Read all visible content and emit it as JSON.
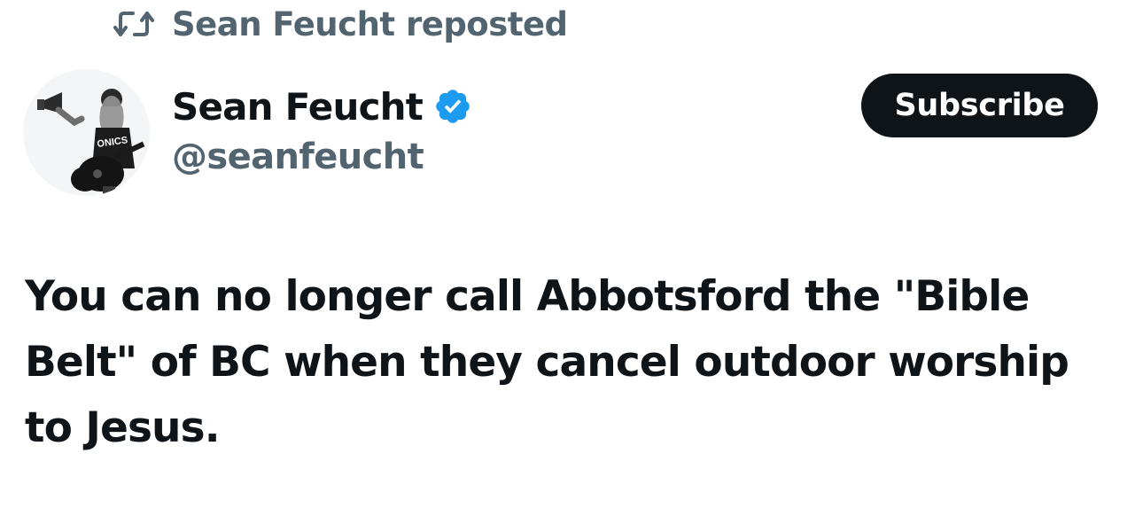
{
  "repost": {
    "icon": "repost-icon",
    "text": "Sean Feucht reposted"
  },
  "author": {
    "avatar_icon": "avatar",
    "display_name": "Sean Feucht",
    "verified_icon": "verified-badge-icon",
    "handle": "@seanfeucht"
  },
  "actions": {
    "subscribe_label": "Subscribe"
  },
  "tweet": {
    "text": "You can no longer call Abbotsford the \"Bible Belt\" of BC when they cancel outdoor worship to Jesus."
  },
  "colors": {
    "primary_text": "#0f1419",
    "secondary_text": "#536471",
    "verified_blue": "#1d9bf0",
    "button_bg": "#0f1419"
  }
}
